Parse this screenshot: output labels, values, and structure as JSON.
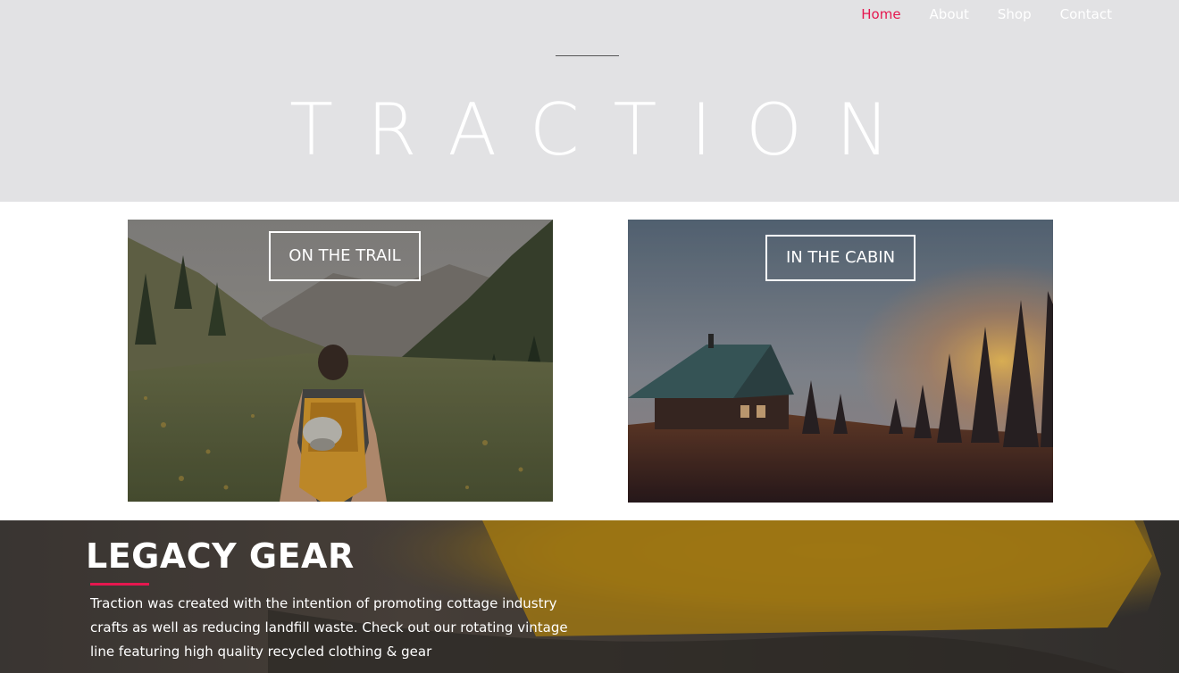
{
  "nav": {
    "items": [
      {
        "label": "Home",
        "active": true
      },
      {
        "label": "About",
        "active": false
      },
      {
        "label": "Shop",
        "active": false
      },
      {
        "label": "Contact",
        "active": false
      }
    ]
  },
  "hero": {
    "title": "TRACTION"
  },
  "cards": [
    {
      "label": "ON THE TRAIL"
    },
    {
      "label": "IN THE CABIN"
    }
  ],
  "legacy": {
    "title": "LEGACY GEAR",
    "body": "Traction was created with the intention of promoting cottage industry crafts as well as reducing landfill waste. Check out our rotating vintage line featuring high quality recycled clothing & gear"
  },
  "colors": {
    "accent": "#e5174f",
    "hero_bg": "#e2e2e4",
    "text_light": "#ffffff"
  }
}
